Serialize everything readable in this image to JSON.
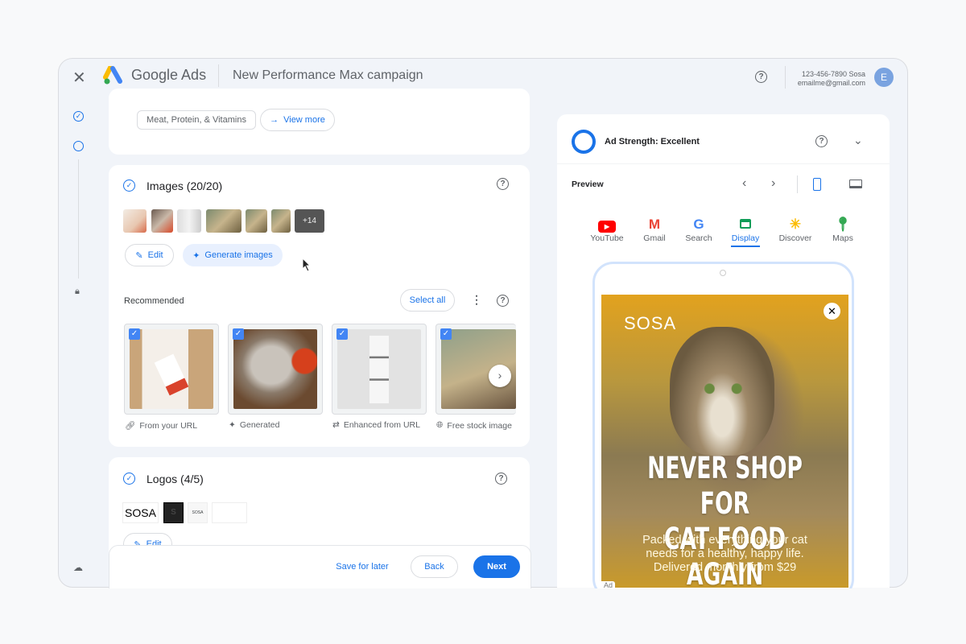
{
  "header": {
    "title_brand": "Google Ads",
    "title_page": "New Performance Max campaign",
    "account_id": "123-456-7890 Sosa",
    "account_email": "emailme@gmail.com",
    "avatar_letter": "E"
  },
  "top_card": {
    "chip": "Meat, Protein, & Vitamins",
    "view_more": "View more"
  },
  "images": {
    "title": "Images (20/20)",
    "more_count": "+14",
    "edit": "Edit",
    "generate": "Generate images",
    "recommended": "Recommended",
    "select_all": "Select all",
    "items": [
      {
        "label": "From your URL",
        "icon": "link-icon"
      },
      {
        "label": "Generated",
        "icon": "sparkle-icon"
      },
      {
        "label": "Enhanced from URL",
        "icon": "enhance-link-icon"
      },
      {
        "label": "Free stock image",
        "icon": "globe-icon"
      }
    ]
  },
  "logos": {
    "title": "Logos (4/5)",
    "logo_text": "SOSA",
    "logo_mark": "S",
    "edit": "Edit"
  },
  "footer": {
    "save": "Save for later",
    "back": "Back",
    "next": "Next"
  },
  "preview": {
    "ad_strength": "Ad Strength: Excellent",
    "label": "Preview",
    "device_selected": "mobile",
    "channels": [
      {
        "name": "YouTube",
        "icon": "youtube-icon"
      },
      {
        "name": "Gmail",
        "icon": "gmail-icon"
      },
      {
        "name": "Search",
        "icon": "google-icon"
      },
      {
        "name": "Display",
        "icon": "display-icon"
      },
      {
        "name": "Discover",
        "icon": "discover-icon"
      },
      {
        "name": "Maps",
        "icon": "maps-icon"
      }
    ],
    "selected_channel": "Display",
    "ad": {
      "brand": "SOSA",
      "headline_1": "NEVER SHOP FOR",
      "headline_2": "CAT FOOD AGAIN",
      "body_1": "Packed with everything your cat",
      "body_2": "needs for a healthy, happy life.",
      "body_3": "Delivered monthly from $29",
      "ad_badge": "Ad"
    }
  },
  "colors": {
    "accent": "#1a73e8",
    "next_button": "#1a73e8"
  }
}
